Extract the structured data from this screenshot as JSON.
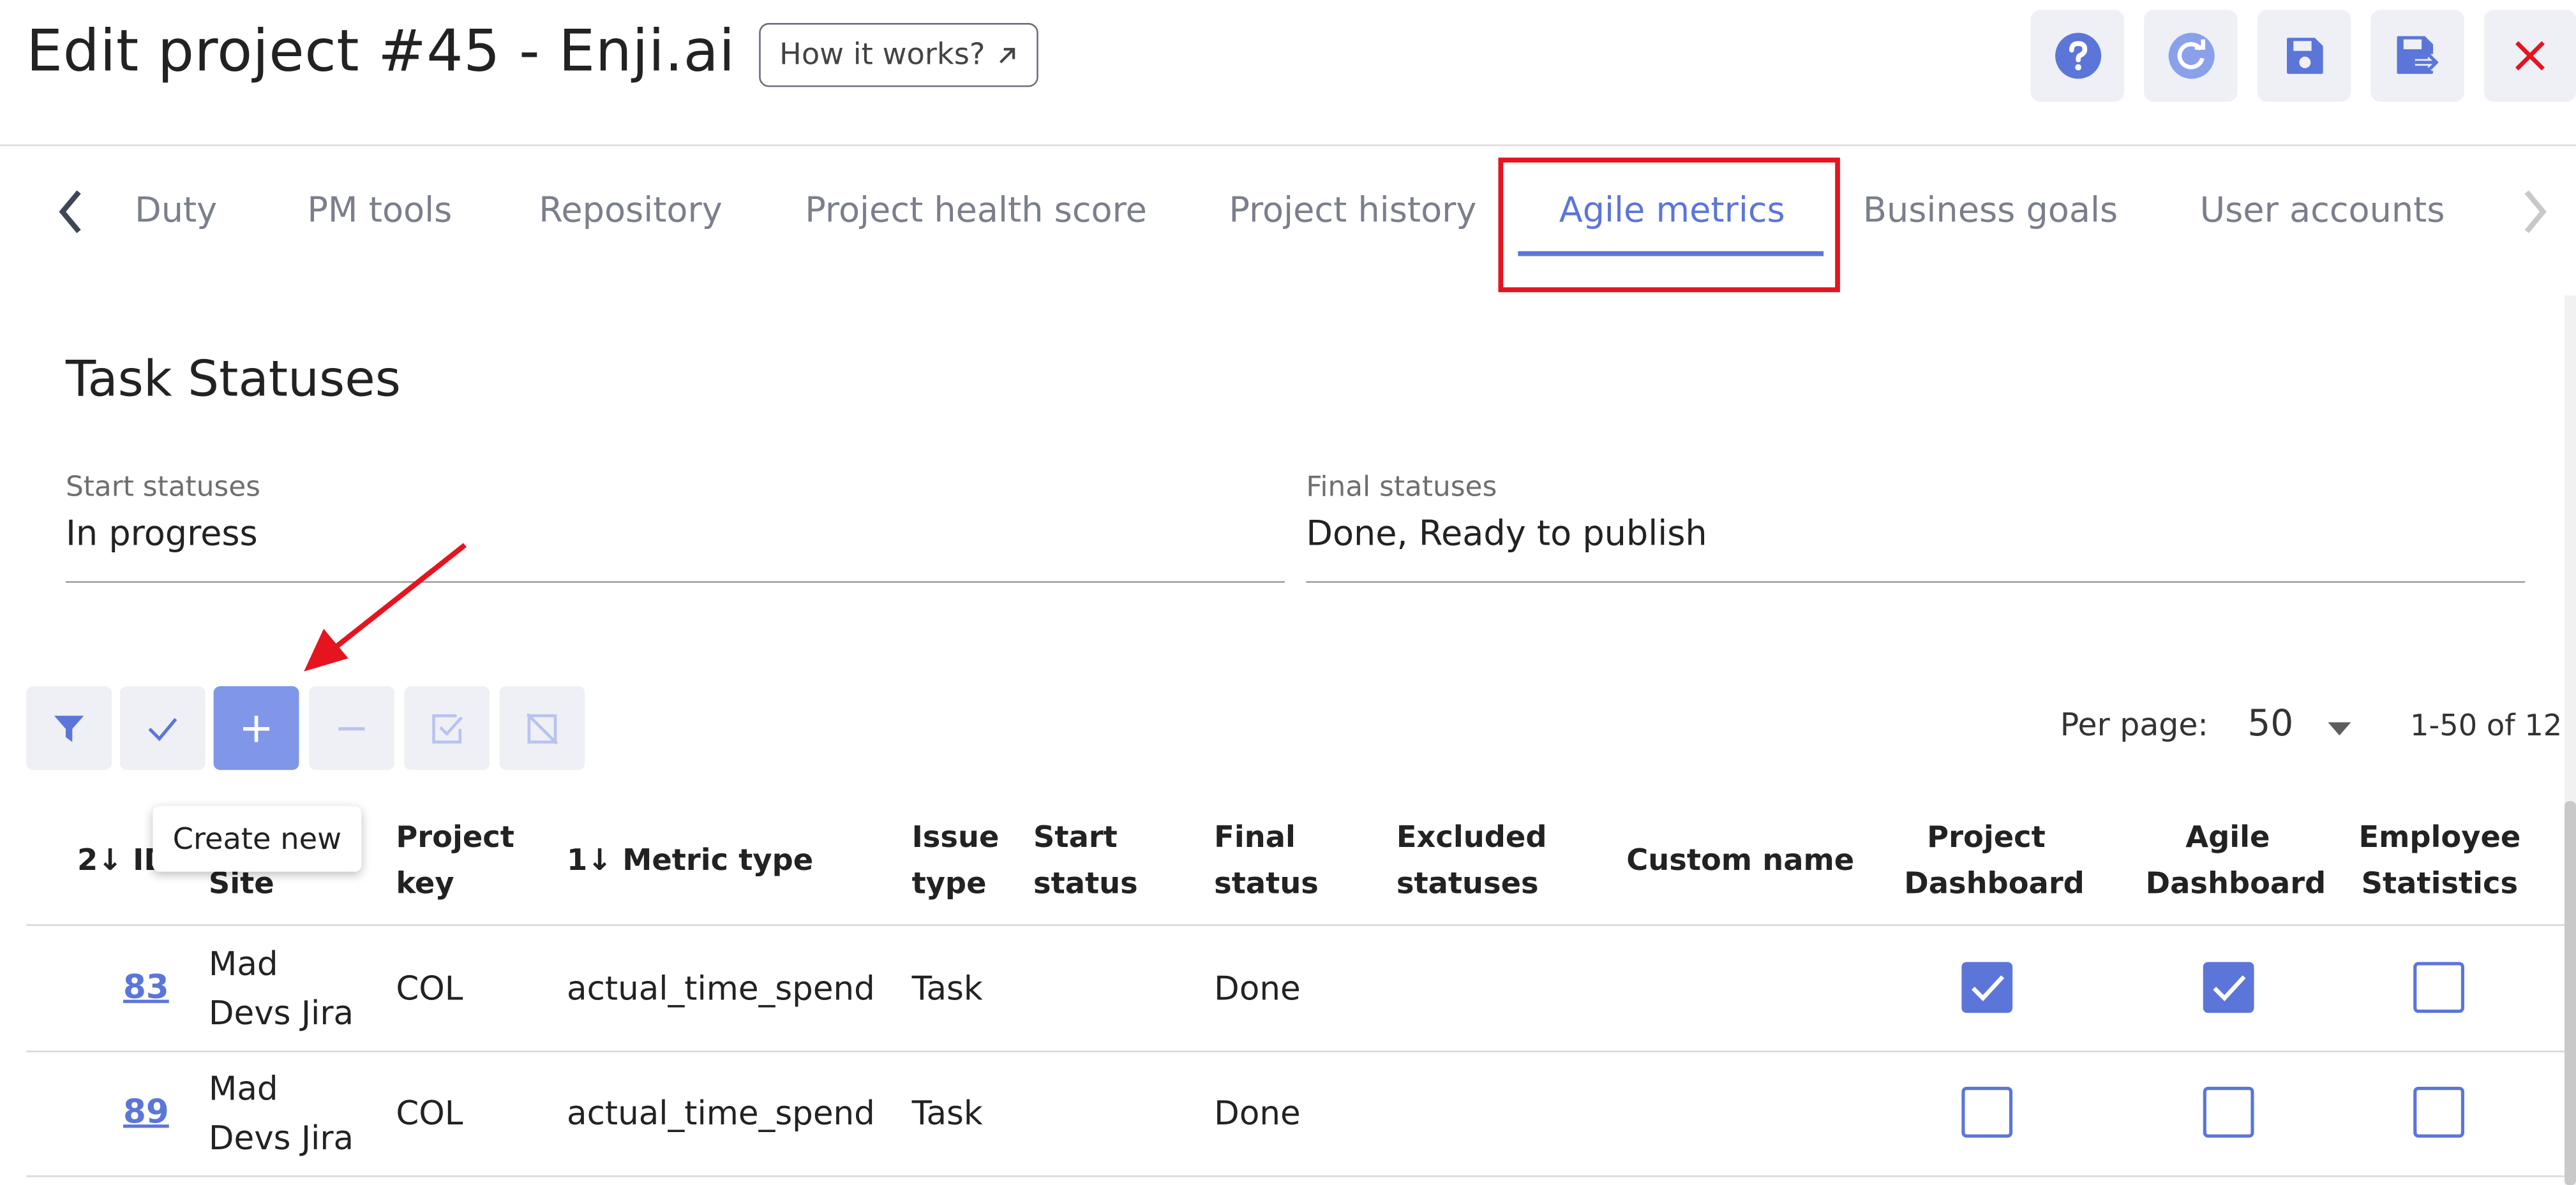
{
  "header": {
    "title": "Edit project #45 - Enji.ai",
    "how_it_works_label": "How it works?",
    "how_it_works_icon": "external-link-arrow",
    "actions": [
      {
        "name": "help-icon"
      },
      {
        "name": "refresh-icon"
      },
      {
        "name": "save-icon"
      },
      {
        "name": "save-and-exit-icon"
      },
      {
        "name": "close-icon"
      }
    ],
    "accent_color": "#5b76d8",
    "close_color": "#e5141f"
  },
  "tabs": {
    "items": [
      "Duty",
      "PM tools",
      "Repository",
      "Project health score",
      "Project history",
      "Agile metrics",
      "Business goals",
      "User accounts"
    ],
    "active": "Agile metrics"
  },
  "section": {
    "title": "Task Statuses",
    "start_label": "Start statuses",
    "start_value": "In progress",
    "final_label": "Final statuses",
    "final_value": "Done, Ready to publish"
  },
  "toolbar": {
    "buttons": [
      {
        "name": "filter-icon"
      },
      {
        "name": "check-icon"
      },
      {
        "name": "plus-icon"
      },
      {
        "name": "minus-icon"
      },
      {
        "name": "check-all-icon"
      },
      {
        "name": "uncheck-all-icon"
      }
    ],
    "tooltip": "Create new",
    "per_page_label": "Per page:",
    "per_page_value": "50",
    "range": "1-50 of 12"
  },
  "table": {
    "headers": {
      "id": [
        "2↓ ID"
      ],
      "site": [
        "Site"
      ],
      "project_key": [
        "Project",
        "key"
      ],
      "metric_type": [
        "1↓ Metric type"
      ],
      "issue_type": [
        "Issue",
        "type"
      ],
      "start_status": [
        "Start",
        "status"
      ],
      "final_status": [
        "Final",
        "status"
      ],
      "excluded_statuses": [
        "Excluded",
        "statuses"
      ],
      "custom_name": [
        "Custom name"
      ],
      "project_dashboard": [
        "Project",
        "Dashboard"
      ],
      "agile_dashboard": [
        "Agile",
        "Dashboard"
      ],
      "employee_statistics": [
        "Employee",
        "Statistics"
      ]
    },
    "rows": [
      {
        "id": "83",
        "site": [
          "Mad",
          "Devs Jira"
        ],
        "project_key": "COL",
        "metric_type": "actual_time_spend",
        "issue_type": "Task",
        "start_status": "",
        "final_status": "Done",
        "excluded_statuses": "",
        "custom_name": "",
        "project_dashboard": true,
        "agile_dashboard": true,
        "employee_statistics": false
      },
      {
        "id": "89",
        "site": [
          "Mad",
          "Devs Jira"
        ],
        "project_key": "COL",
        "metric_type": "actual_time_spend",
        "issue_type": "Task",
        "start_status": "",
        "final_status": "Done",
        "excluded_statuses": "",
        "custom_name": "",
        "project_dashboard": false,
        "agile_dashboard": false,
        "employee_statistics": false
      }
    ]
  }
}
